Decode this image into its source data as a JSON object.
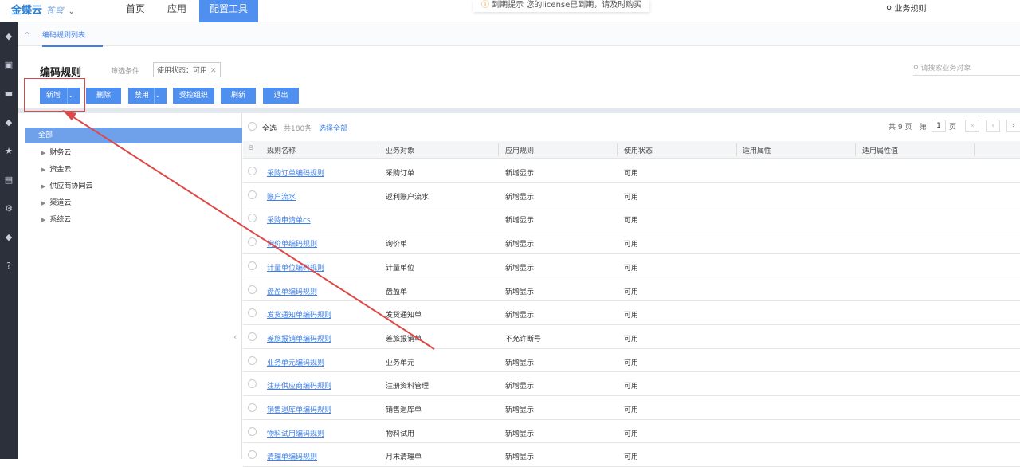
{
  "topbar": {
    "logo": "金蝶云",
    "logo_sub": "苍穹",
    "nav": [
      {
        "label": "首页"
      },
      {
        "label": "应用"
      },
      {
        "label": "配置工具",
        "active": true
      }
    ],
    "notice_title": "到期提示",
    "notice_text": "您的license已到期，请及时购买",
    "search_value": "业务规则"
  },
  "breadcrumb": {
    "tab": "编码规则列表"
  },
  "page": {
    "title": "编码规则",
    "filter_label": "筛选条件",
    "filter_chip": "使用状态：可用",
    "search_placeholder": "请搜索业务对象"
  },
  "toolbar": {
    "add": "新增",
    "delete": "删除",
    "disable": "禁用",
    "controlled_org": "受控组织",
    "refresh": "刷新",
    "exit": "退出"
  },
  "tree": {
    "root": "全部",
    "children": [
      "财务云",
      "资金云",
      "供应商协同云",
      "渠道云",
      "系统云"
    ]
  },
  "table": {
    "select_all": "全选",
    "total": "共180条",
    "select_all_link": "选择全部",
    "pager": {
      "total_pages": "共 9 页",
      "page_prefix": "第",
      "page": "1",
      "page_suffix": "页"
    },
    "columns": [
      "规则名称",
      "业务对象",
      "应用规则",
      "使用状态",
      "适用属性",
      "适用属性值"
    ],
    "rows": [
      [
        "采购订单编码规则",
        "采购订单",
        "新增显示",
        "可用"
      ],
      [
        "账户流水",
        "返利账户流水",
        "新增显示",
        "可用"
      ],
      [
        "采购申请单cs",
        "",
        "新增显示",
        "可用"
      ],
      [
        "询价单编码规则",
        "询价单",
        "新增显示",
        "可用"
      ],
      [
        "计量单位编码规则",
        "计量单位",
        "新增显示",
        "可用"
      ],
      [
        "盘盈单编码规则",
        "盘盈单",
        "新增显示",
        "可用"
      ],
      [
        "发货通知单编码规则",
        "发货通知单",
        "新增显示",
        "可用"
      ],
      [
        "差旅报销单编码规则",
        "差旅报销单",
        "不允许断号",
        "可用"
      ],
      [
        "业务单元编码规则",
        "业务单元",
        "新增显示",
        "可用"
      ],
      [
        "注册供应商编码规则",
        "注册资料管理",
        "新增显示",
        "可用"
      ],
      [
        "销售退库单编码规则",
        "销售退库单",
        "新增显示",
        "可用"
      ],
      [
        "物料试用编码规则",
        "物料试用",
        "新增显示",
        "可用"
      ],
      [
        "清理单编码规则",
        "月末清理单",
        "新增显示",
        "可用"
      ]
    ]
  },
  "colors": {
    "accent": "#4f8ff0",
    "annotation": "#e04848"
  }
}
